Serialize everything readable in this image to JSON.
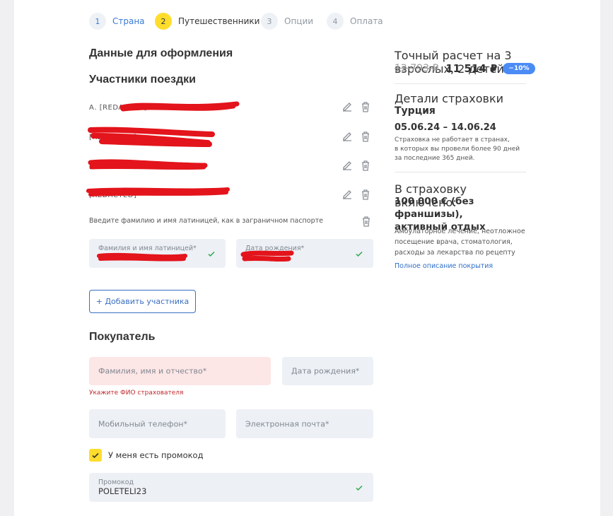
{
  "stepper": [
    {
      "num": "1",
      "label": "Страна"
    },
    {
      "num": "2",
      "label": "Путешественники"
    },
    {
      "num": "3",
      "label": "Опции"
    },
    {
      "num": "4",
      "label": "Оплата"
    }
  ],
  "form": {
    "title": "Данные для оформления",
    "participants_title": "Участники поездки",
    "travelers": [
      "А. [REDACTED]",
      "[REDACTED]",
      "[REDACTED]",
      "[REDACTED]"
    ],
    "latin_hint": "Введите фамилию и имя латиницей, как в заграничном паспорте",
    "latin_name_label": "Фамилия и имя латиницей*",
    "birth_date_label": "Дата рождения*",
    "add_participant": "+ Добавить участника"
  },
  "buyer": {
    "title": "Покупатель",
    "fio_label": "Фамилия, имя и отчество*",
    "birth_label": "Дата рождения*",
    "fio_error": "Укажите ФИО страхователя",
    "phone_label": "Мобильный телефон*",
    "email_label": "Электронная почта*",
    "promo_checkbox_label": "У меня есть промокод",
    "promo_label": "Промокод",
    "promo_value": "POLETELI23"
  },
  "summary": {
    "calc_note": "Точный расчет на 3 взрослых, 2 детей",
    "old_price": "12 793 ₽",
    "new_price": "11 514 ₽",
    "discount": "−10%",
    "details_label": "Детали страховки",
    "country": "Турция",
    "dates": "05.06.24 – 14.06.24",
    "note_lines": [
      "Страховка не работает в странах,",
      "в которых вы провели более 90 дней",
      "за последние 365 дней."
    ],
    "included_label": "В страховку включено:",
    "coverage_lines": [
      "100 000 € (без франшизы),",
      "активный отдых"
    ],
    "coverage_desc_lines": [
      "Амбулаторное лечение, неотложное",
      "посещение врача, стоматология,",
      "расходы за лекарства по рецепту"
    ],
    "full_link": "Полное описание покрытия"
  },
  "colors": {
    "accent_yellow": "#ffdd2d",
    "link_blue": "#3a7bd5",
    "badge_blue": "#4a8bf5",
    "error_red": "#c0282e",
    "field_bg": "#edf0f5",
    "error_bg": "#fde6e6"
  }
}
